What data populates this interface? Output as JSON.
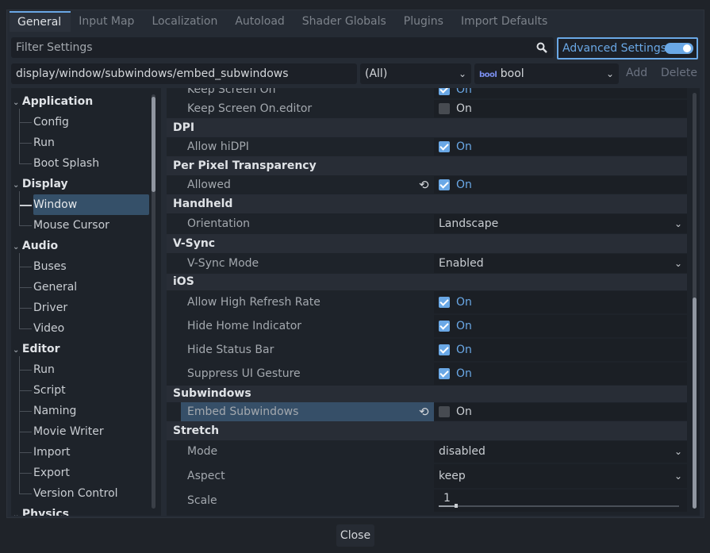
{
  "tabs": [
    {
      "label": "General",
      "active": true
    },
    {
      "label": "Input Map"
    },
    {
      "label": "Localization"
    },
    {
      "label": "Autoload"
    },
    {
      "label": "Shader Globals"
    },
    {
      "label": "Plugins"
    },
    {
      "label": "Import Defaults"
    }
  ],
  "filter": {
    "placeholder": "Filter Settings",
    "icon": "search-icon"
  },
  "advanced": {
    "label": "Advanced Settings",
    "enabled": true
  },
  "path_input": {
    "value": "display/window/subwindows/embed_subwindows"
  },
  "feature_select": {
    "value": "(All)"
  },
  "type_select": {
    "value": "bool",
    "icon_text": "bool"
  },
  "add_label": "Add",
  "delete_label": "Delete",
  "tree": [
    {
      "label": "Application",
      "type": "section"
    },
    {
      "label": "Config"
    },
    {
      "label": "Run"
    },
    {
      "label": "Boot Splash"
    },
    {
      "label": "Display",
      "type": "section"
    },
    {
      "label": "Window",
      "selected": true
    },
    {
      "label": "Mouse Cursor"
    },
    {
      "label": "Audio",
      "type": "section"
    },
    {
      "label": "Buses"
    },
    {
      "label": "General"
    },
    {
      "label": "Driver"
    },
    {
      "label": "Video"
    },
    {
      "label": "Editor",
      "type": "section"
    },
    {
      "label": "Run"
    },
    {
      "label": "Script"
    },
    {
      "label": "Naming"
    },
    {
      "label": "Movie Writer"
    },
    {
      "label": "Import"
    },
    {
      "label": "Export"
    },
    {
      "label": "Version Control"
    },
    {
      "label": "Physics",
      "type": "section"
    }
  ],
  "properties": [
    {
      "type": "bool",
      "label": "Keep Screen On",
      "value": true,
      "text": "On"
    },
    {
      "type": "bool",
      "label": "Keep Screen On.editor",
      "value": false,
      "text": "On"
    },
    {
      "type": "header",
      "label": "DPI"
    },
    {
      "type": "bool",
      "label": "Allow hiDPI",
      "value": true,
      "text": "On"
    },
    {
      "type": "header",
      "label": "Per Pixel Transparency"
    },
    {
      "type": "bool",
      "label": "Allowed",
      "value": true,
      "text": "On",
      "revert": true
    },
    {
      "type": "header",
      "label": "Handheld"
    },
    {
      "type": "enum",
      "label": "Orientation",
      "value": "Landscape"
    },
    {
      "type": "header",
      "label": "V-Sync"
    },
    {
      "type": "enum",
      "label": "V-Sync Mode",
      "value": "Enabled"
    },
    {
      "type": "header",
      "label": "iOS"
    },
    {
      "type": "bool",
      "label": "Allow High Refresh Rate",
      "value": true,
      "text": "On"
    },
    {
      "type": "bool",
      "label": "Hide Home Indicator",
      "value": true,
      "text": "On"
    },
    {
      "type": "bool",
      "label": "Hide Status Bar",
      "value": true,
      "text": "On"
    },
    {
      "type": "bool",
      "label": "Suppress UI Gesture",
      "value": true,
      "text": "On"
    },
    {
      "type": "header",
      "label": "Subwindows"
    },
    {
      "type": "bool",
      "label": "Embed Subwindows",
      "value": false,
      "text": "On",
      "revert": true,
      "selected": true
    },
    {
      "type": "header",
      "label": "Stretch"
    },
    {
      "type": "enum",
      "label": "Mode",
      "value": "disabled"
    },
    {
      "type": "enum",
      "label": "Aspect",
      "value": "keep"
    },
    {
      "type": "slider",
      "label": "Scale",
      "value": "1"
    }
  ],
  "close_label": "Close",
  "colors": {
    "accent": "#6aa8e6",
    "background": "#1f2329",
    "panel": "#252b34",
    "selection": "#355069"
  }
}
